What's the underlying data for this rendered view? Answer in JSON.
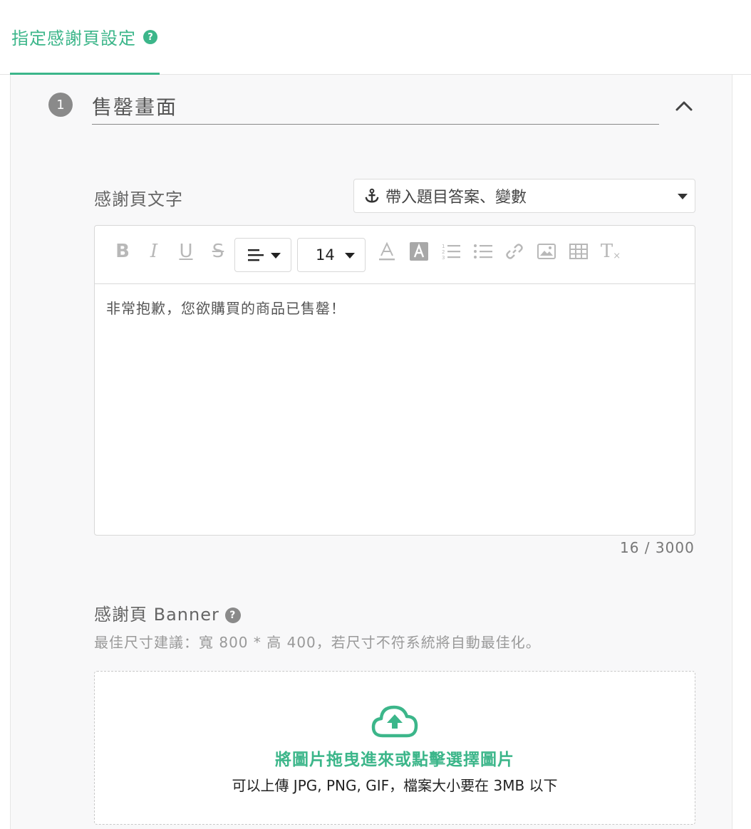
{
  "tabs": [
    {
      "label": "指定感謝頁設定",
      "help": "?"
    }
  ],
  "section": {
    "step_number": "1",
    "title": "售罄畫面"
  },
  "thank_text": {
    "label": "感謝頁文字",
    "variable_select": "帶入題目答案、變數",
    "toolbar": {
      "bold": "B",
      "italic": "I",
      "underline": "U",
      "strike": "S",
      "font_size": "14",
      "clear_format": "T"
    },
    "content": "非常抱歉，您欲購買的商品已售罄！",
    "counter": "16 / 3000"
  },
  "banner": {
    "label": "感謝頁 Banner",
    "help": "?",
    "hint": "最佳尺寸建議：寬 800 * 高 400，若尺寸不符系統將自動最佳化。",
    "upload_main": "將圖片拖曳進來或點擊選擇圖片",
    "upload_sub": "可以上傳 JPG, PNG, GIF，檔案大小要在 3MB 以下"
  },
  "colors": {
    "accent": "#3cb68a",
    "step_badge": "#8a8a8a"
  },
  "icons": [
    "help-icon",
    "chevron-up-icon",
    "anchor-icon",
    "align-left-icon",
    "font-color-icon",
    "background-color-icon",
    "ordered-list-icon",
    "bullet-list-icon",
    "link-icon",
    "image-icon",
    "table-icon",
    "clear-format-icon",
    "cloud-upload-icon"
  ]
}
